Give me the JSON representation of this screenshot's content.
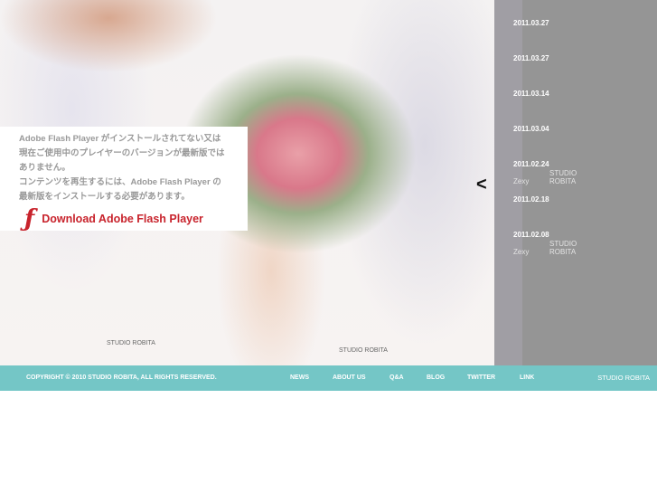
{
  "flash_notice": {
    "lines": [
      "Adobe Flash Player がインストールされてない又は",
      "現在ご使用中のプレイヤーのバージョンが最新版では",
      "ありません。",
      "コンテンツを再生するには、Adobe Flash Player の",
      "最新版をインストールする必要があります。"
    ],
    "download_label": "Download Adobe Flash Player"
  },
  "news": [
    {
      "date": "2011.03.27"
    },
    {
      "date": "2011.03.27"
    },
    {
      "date": "2011.03.14"
    },
    {
      "date": "2011.03.04"
    },
    {
      "date": "2011.02.24",
      "source": "Zexy",
      "credit": "STUDIO ROBITA"
    },
    {
      "date": "2011.02.18"
    },
    {
      "date": "2011.02.08",
      "source": "Zexy",
      "credit": "STUDIO ROBITA"
    }
  ],
  "captions": [
    "STUDIO ROBITA",
    "STUDIO ROBITA"
  ],
  "footer": {
    "copyright": "COPYRIGHT © 2010 STUDIO ROBITA, ALL RIGHTS RESERVED.",
    "nav": [
      "NEWS",
      "ABOUT US",
      "Q&A",
      "BLOG",
      "TWITTER",
      "LINK"
    ],
    "brand": "STUDIO ROBITA"
  },
  "colors": {
    "footer": "#74c6c6",
    "side": "#959595",
    "accent": "#c8232c"
  }
}
